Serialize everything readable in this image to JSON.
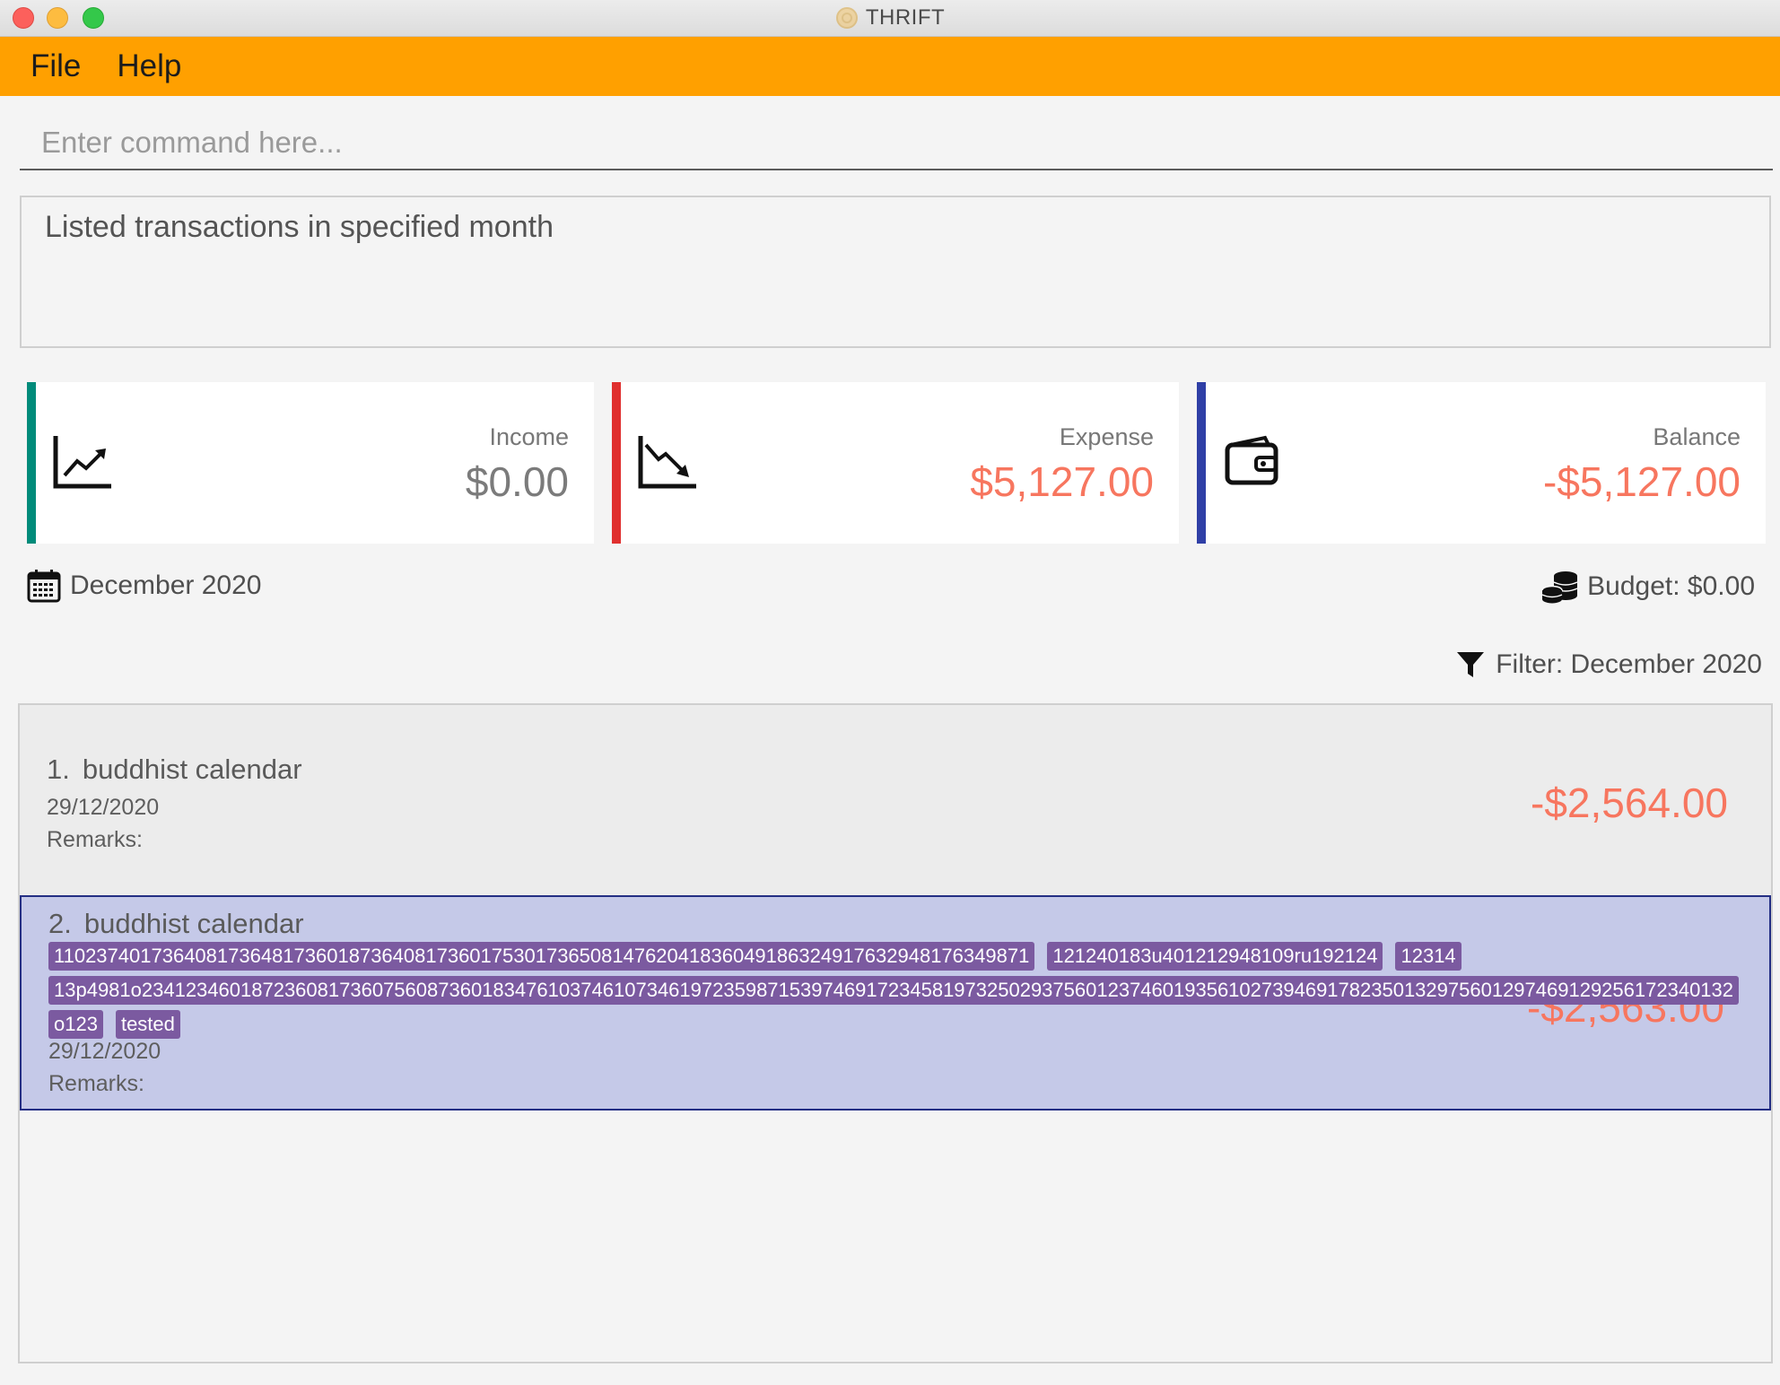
{
  "window": {
    "title": "THRIFT"
  },
  "menu": {
    "items": [
      "File",
      "Help"
    ]
  },
  "command": {
    "placeholder": "Enter command here...",
    "value": ""
  },
  "result": {
    "message": "Listed transactions in specified month"
  },
  "summary": {
    "income": {
      "label": "Income",
      "value": "$0.00",
      "icon": "trend-up-chart-icon",
      "color": "#008b7a"
    },
    "expense": {
      "label": "Expense",
      "value": "$5,127.00",
      "icon": "trend-down-chart-icon",
      "color": "#e0302f"
    },
    "balance": {
      "label": "Balance",
      "value": "-$5,127.00",
      "icon": "wallet-icon",
      "color": "#2f3fa6"
    }
  },
  "period": {
    "month": "December 2020",
    "icon": "calendar-icon"
  },
  "budget": {
    "text": "Budget: $0.00",
    "icon": "coins-icon"
  },
  "filter": {
    "text": "Filter: December 2020",
    "icon": "filter-icon"
  },
  "transactions": [
    {
      "index": "1.",
      "description": "buddhist calendar",
      "date": "29/12/2020",
      "remarks": "Remarks:",
      "amount": "-$2,564.00",
      "tags": []
    },
    {
      "index": "2.",
      "description": "buddhist calendar",
      "date": "29/12/2020",
      "remarks": "Remarks:",
      "amount": "-$2,563.00",
      "tags": [
        "11023740173640817364817360187364081736017530173650814762041836049186324917632948176349871",
        "121240183u401212948109ru192124",
        "12314",
        "13p4981o2341234601872360817360756087360183476103746107346197235987153974691723458197325029375601237460193561027394691782350132975601297469129256172340132",
        "o123",
        "tested"
      ]
    }
  ],
  "colors": {
    "accent": "#ffa000",
    "negative_amount": "#f7765f",
    "selected_row": "#c5c9e8",
    "tag": "#7b5aa0"
  }
}
